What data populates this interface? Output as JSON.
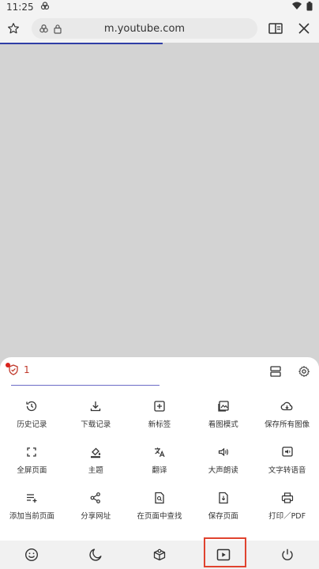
{
  "status_bar": {
    "time": "11:25"
  },
  "toolbar": {
    "url": "m.youtube.com",
    "load_progress": 0.51
  },
  "menu": {
    "blocked_count": "1",
    "rows": [
      [
        {
          "label": "历史记录",
          "icon": "history-icon"
        },
        {
          "label": "下载记录",
          "icon": "download-icon"
        },
        {
          "label": "新标签",
          "icon": "new-tab-icon"
        },
        {
          "label": "看图模式",
          "icon": "image-view-icon"
        },
        {
          "label": "保存所有图像",
          "icon": "cloud-save-icon"
        }
      ],
      [
        {
          "label": "全屏页面",
          "icon": "fullscreen-icon"
        },
        {
          "label": "主题",
          "icon": "theme-icon"
        },
        {
          "label": "翻译",
          "icon": "translate-icon"
        },
        {
          "label": "大声朗读",
          "icon": "read-aloud-icon"
        },
        {
          "label": "文字转语音",
          "icon": "text-to-speech-icon"
        }
      ],
      [
        {
          "label": "添加当前页面",
          "icon": "add-page-icon"
        },
        {
          "label": "分享网址",
          "icon": "share-icon"
        },
        {
          "label": "在页面中查找",
          "icon": "find-in-page-icon"
        },
        {
          "label": "保存页面",
          "icon": "save-page-icon"
        },
        {
          "label": "打印／PDF",
          "icon": "print-icon"
        }
      ]
    ]
  },
  "bottom_bar": [
    "emoji-icon",
    "night-mode-icon",
    "extensions-icon",
    "video-player-icon",
    "power-icon"
  ],
  "colors": {
    "accent": "#2f3ea6",
    "danger": "#d9221c",
    "highlight": "#e0432f"
  }
}
